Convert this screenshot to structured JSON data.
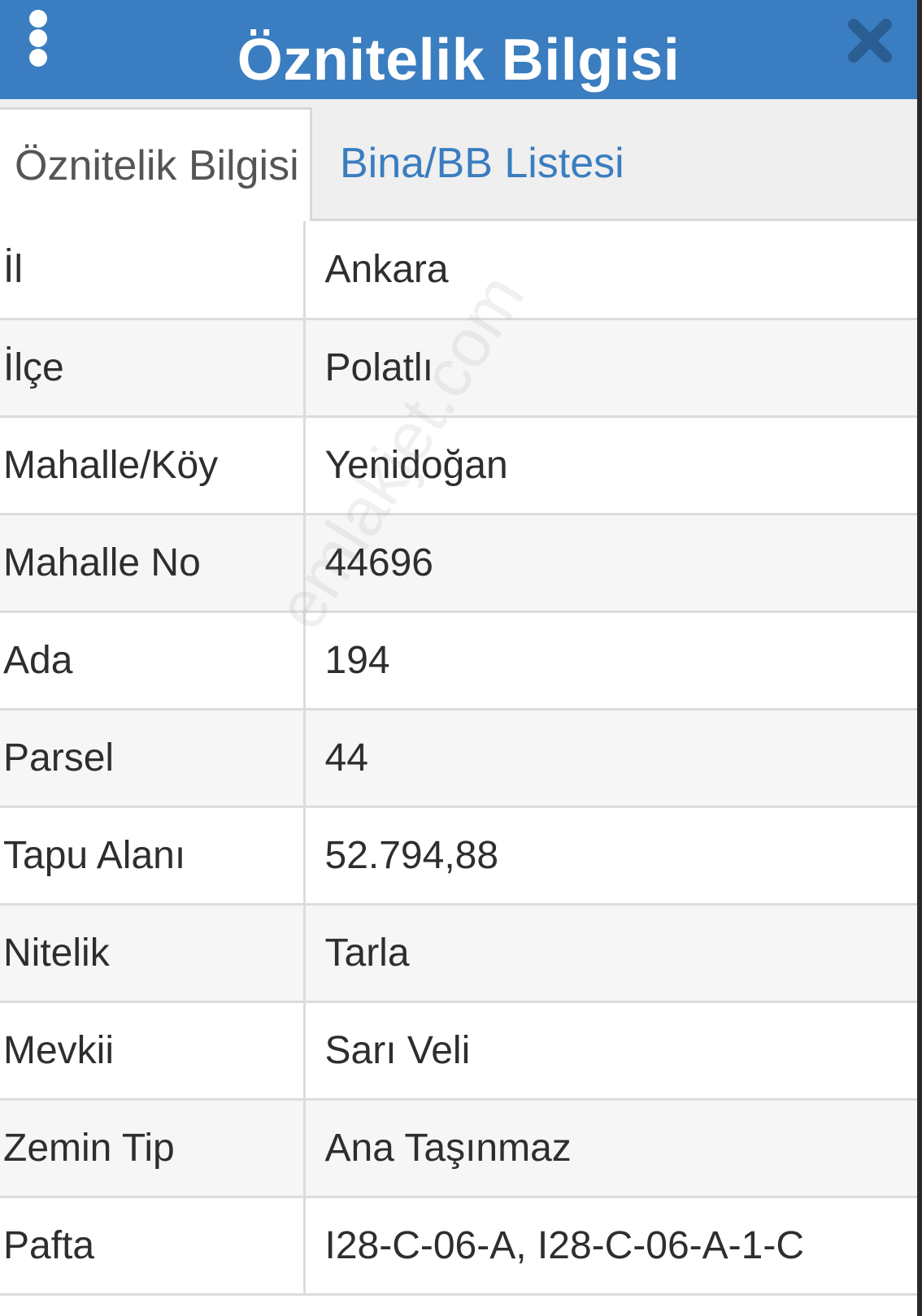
{
  "header": {
    "title": "Öznitelik Bilgisi",
    "menu_icon": "more-vertical-icon",
    "close_icon": "close-icon",
    "background_color": "#3a7dc0"
  },
  "tabs": [
    {
      "label": "Öznitelik Bilgisi",
      "active": true
    },
    {
      "label": "Bina/BB Listesi",
      "active": false
    }
  ],
  "attributes": [
    {
      "key": "İl",
      "value": "Ankara"
    },
    {
      "key": "İlçe",
      "value": "Polatlı"
    },
    {
      "key": "Mahalle/Köy",
      "value": "Yenidoğan"
    },
    {
      "key": "Mahalle No",
      "value": "44696"
    },
    {
      "key": "Ada",
      "value": "194"
    },
    {
      "key": "Parsel",
      "value": "44"
    },
    {
      "key": "Tapu Alanı",
      "value": "52.794,88"
    },
    {
      "key": "Nitelik",
      "value": "Tarla"
    },
    {
      "key": "Mevkii",
      "value": "Sarı Veli"
    },
    {
      "key": "Zemin Tip",
      "value": "Ana Taşınmaz"
    },
    {
      "key": "Pafta",
      "value": "I28-C-06-A, I28-C-06-A-1-C"
    }
  ],
  "watermark": "emlakjet.com"
}
